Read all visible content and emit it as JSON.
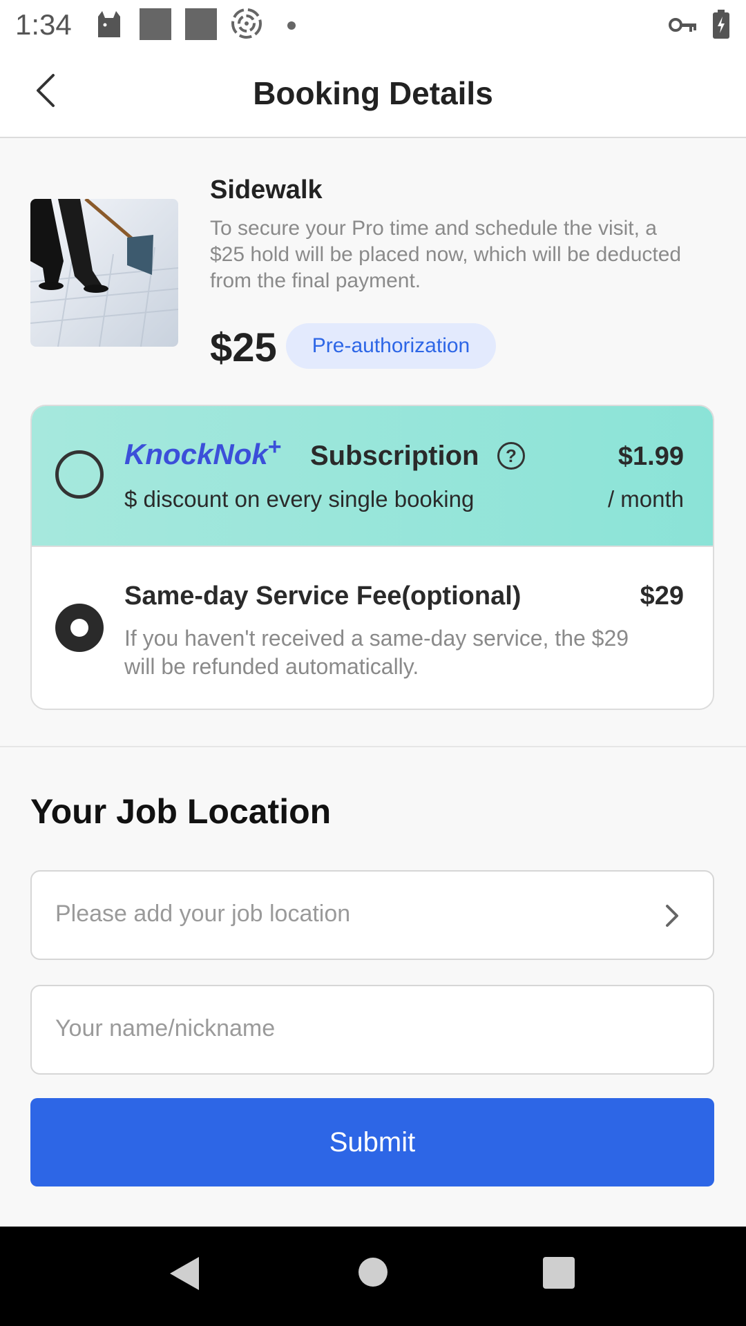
{
  "status_bar": {
    "time": "1:34",
    "icons": [
      "cat-notification-icon",
      "square-notification-icon",
      "square-notification-icon",
      "spiral-icon",
      "dot-icon",
      "vpn-key-icon",
      "battery-charging-icon"
    ]
  },
  "header": {
    "title": "Booking Details",
    "back_icon": "chevron-left-icon"
  },
  "service": {
    "name": "Sidewalk",
    "description": "To secure your Pro time and schedule the visit, a $25 hold will be placed now, which will be deducted from the final payment.",
    "price": "$25",
    "badge": "Pre-authorization"
  },
  "subscription": {
    "brand": "KnockNok",
    "brand_plus": "+",
    "label": "Subscription",
    "help_icon": "question-circle-icon",
    "help_glyph": "?",
    "description": "$ discount on every single booking",
    "price": "$1.99",
    "period": "/ month",
    "selected": false
  },
  "sameday": {
    "title": "Same-day Service Fee(optional)",
    "price": "$29",
    "description": "If you haven't received a same-day service, the $29 will be refunded automatically.",
    "selected": true
  },
  "location": {
    "heading": "Your Job Location",
    "location_placeholder": "Please add your job location",
    "name_placeholder": "Your name/nickname"
  },
  "submit_label": "Submit",
  "colors": {
    "accent": "#2d66e6",
    "badge_bg": "#e3eafd",
    "subscription_bg": "#9ae6da",
    "brand": "#3b4fd9"
  }
}
